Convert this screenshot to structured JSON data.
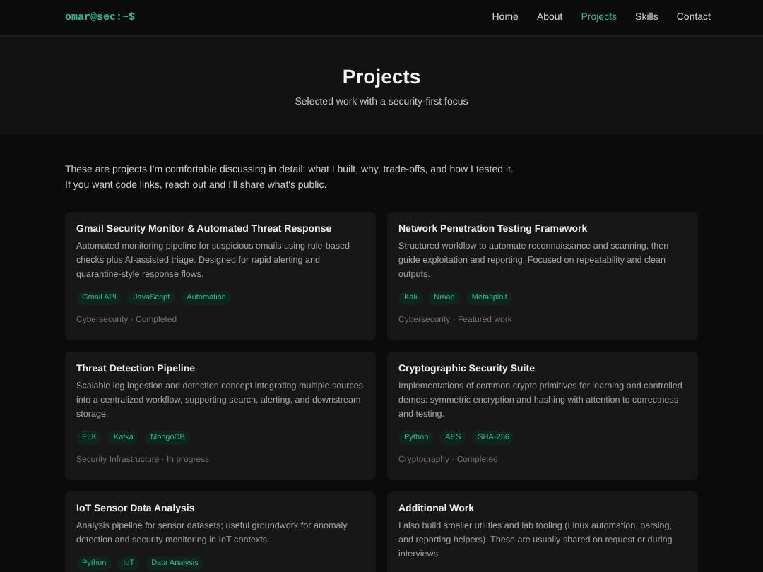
{
  "brand": "omar@sec:~$",
  "nav": [
    {
      "label": "Home",
      "selected": false
    },
    {
      "label": "About",
      "selected": false
    },
    {
      "label": "Projects",
      "selected": true
    },
    {
      "label": "Skills",
      "selected": false
    },
    {
      "label": "Contact",
      "selected": false
    }
  ],
  "hero": {
    "title": "Projects",
    "subtitle": "Selected work with a security-first focus"
  },
  "intro": "These are projects I'm comfortable discussing in detail: what I built, why, trade-offs, and how I tested it. If you want code links, reach out and I'll share what's public.",
  "projects": [
    {
      "title": "Gmail Security Monitor & Automated Threat Response",
      "description": "Automated monitoring pipeline for suspicious emails using rule-based checks plus AI-assisted triage. Designed for rapid alerting and quarantine-style response flows.",
      "tags": [
        "Gmail API",
        "JavaScript",
        "Automation"
      ],
      "meta": "Cybersecurity · Completed"
    },
    {
      "title": "Network Penetration Testing Framework",
      "description": "Structured workflow to automate reconnaissance and scanning, then guide exploitation and reporting. Focused on repeatability and clean outputs.",
      "tags": [
        "Kali",
        "Nmap",
        "Metasploit"
      ],
      "meta": "Cybersecurity · Featured work"
    },
    {
      "title": "Threat Detection Pipeline",
      "description": "Scalable log ingestion and detection concept integrating multiple sources into a centralized workflow, supporting search, alerting, and downstream storage.",
      "tags": [
        "ELK",
        "Kafka",
        "MongoDB"
      ],
      "meta": "Security Infrastructure · In progress"
    },
    {
      "title": "Cryptographic Security Suite",
      "description": "Implementations of common crypto primitives for learning and controlled demos: symmetric encryption and hashing with attention to correctness and testing.",
      "tags": [
        "Python",
        "AES",
        "SHA-256"
      ],
      "meta": "Cryptography · Completed"
    },
    {
      "title": "IoT Sensor Data Analysis",
      "description": "Analysis pipeline for sensor datasets; useful groundwork for anomaly detection and security monitoring in IoT contexts.",
      "tags": [
        "Python",
        "IoT",
        "Data Analysis"
      ]
    },
    {
      "title": "Additional Work",
      "description": "I also build smaller utilities and lab tooling (Linux automation, parsing, and reporting helpers). These are usually shared on request or during interviews."
    }
  ]
}
